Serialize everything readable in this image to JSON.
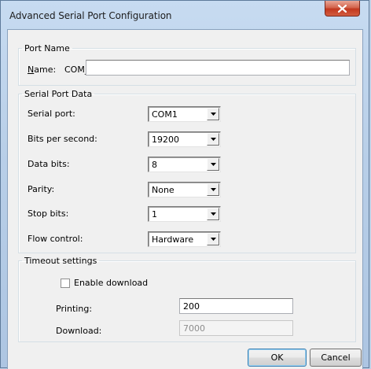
{
  "window": {
    "title": "Advanced Serial Port Configuration",
    "close_glyph": "x"
  },
  "port_name": {
    "legend": "Port Name",
    "name_label_underlined": "N",
    "name_label_rest": "ame:",
    "prefix": "COM_",
    "name_value": ""
  },
  "serial_port_data": {
    "legend": "Serial Port Data",
    "fields": [
      {
        "label": "Serial port:",
        "value": "COM1"
      },
      {
        "label": "Bits per second:",
        "value": "19200"
      },
      {
        "label": "Data bits:",
        "value": "8"
      },
      {
        "label": "Parity:",
        "value": "None"
      },
      {
        "label": "Stop bits:",
        "value": "1"
      },
      {
        "label": "Flow control:",
        "value": "Hardware"
      }
    ]
  },
  "timeout": {
    "legend": "Timeout settings",
    "enable_download_label": "Enable download",
    "enable_download_checked": false,
    "printing_label": "Printing:",
    "printing_value": "200",
    "download_label": "Download:",
    "download_value": "7000"
  },
  "buttons": {
    "ok": "OK",
    "cancel": "Cancel"
  }
}
